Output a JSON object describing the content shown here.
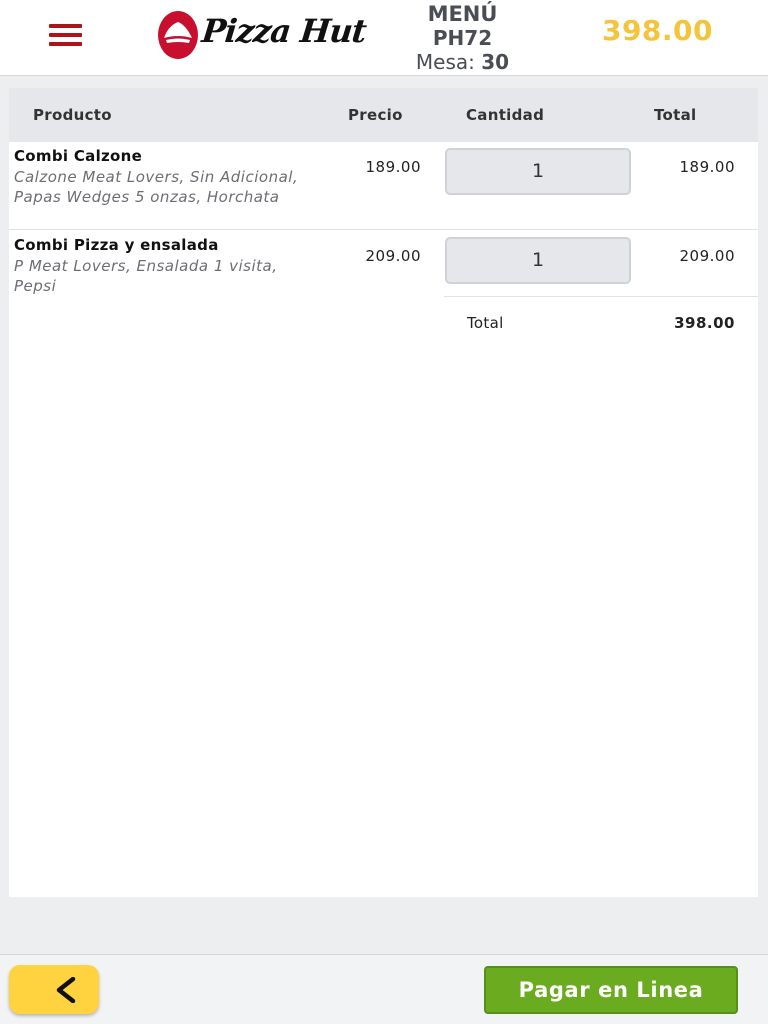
{
  "header": {
    "brand": "Pizza Hut",
    "menu_title": "MENÚ",
    "store_code": "PH72",
    "table_label": "Mesa:",
    "table_number": "30",
    "cart_total": "398.00",
    "accent_color": "#f6c43a",
    "brand_color": "#b0121c"
  },
  "table": {
    "columns": [
      "Producto",
      "Precio",
      "Cantidad",
      "Total"
    ],
    "rows": [
      {
        "name": "Combi Calzone",
        "description": "Calzone Meat Lovers, Sin Adicional, Papas Wedges 5 onzas, Horchata",
        "price": "189.00",
        "quantity": "1",
        "total": "189.00"
      },
      {
        "name": "Combi Pizza y ensalada",
        "description": "P Meat Lovers, Ensalada 1 visita, Pepsi",
        "price": "209.00",
        "quantity": "1",
        "total": "209.00"
      }
    ],
    "total_label": "Total",
    "total_value": "398.00"
  },
  "footer": {
    "back_icon": "chevron-left-icon",
    "pay_label": "Pagar en Linea",
    "pay_color": "#6aab1f"
  }
}
